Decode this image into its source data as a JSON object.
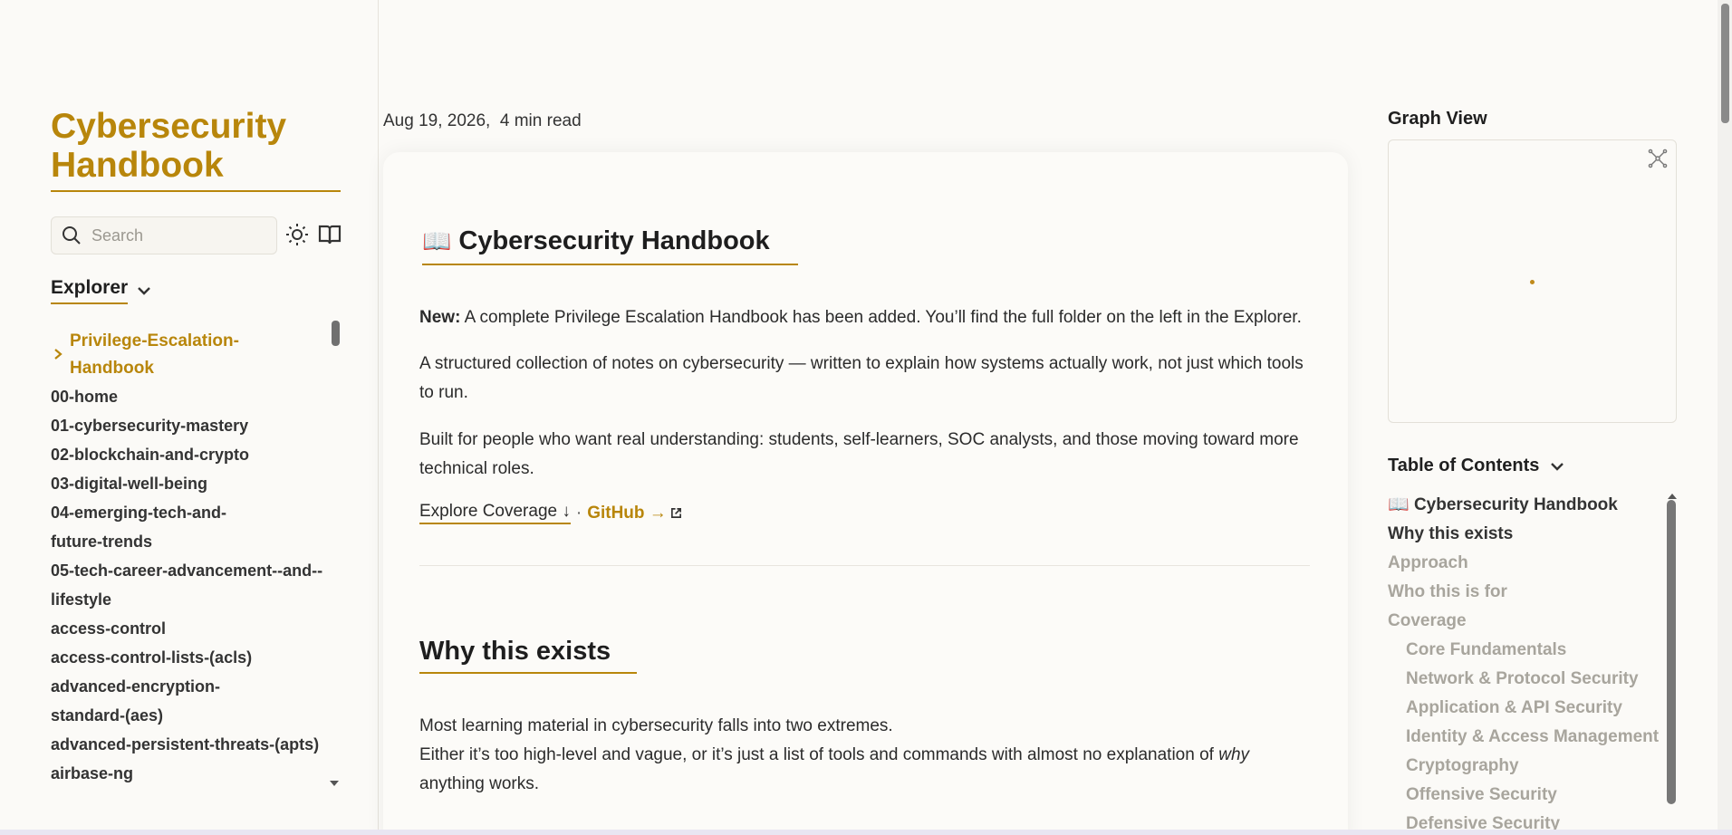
{
  "site": {
    "title": "Cybersecurity Handbook"
  },
  "search": {
    "placeholder": "Search"
  },
  "explorer": {
    "label": "Explorer",
    "folder": "Privilege-Escalation-Handbook",
    "items": [
      "00-home",
      "01-cybersecurity-mastery",
      "02-blockchain-and-crypto",
      "03-digital-well-being",
      "04-emerging-tech-and-future-trends",
      "05-tech-career-advancement--and--lifestyle",
      "access-control",
      "access-control-lists-(acls)",
      "advanced-encryption-standard-(aes)",
      "advanced-persistent-threats-(apts)",
      "airbase-ng"
    ]
  },
  "article": {
    "meta": "Aug 19, 2026,  4 min read",
    "title": "Cybersecurity Handbook",
    "title_icon": "📖",
    "new_label": "New:",
    "new_text": " A complete Privilege Escalation Handbook has been added. You’ll find the full folder on the left in the Explorer.",
    "para1": "A structured collection of notes on cybersecurity — written to explain how systems actually work, not just which tools to run.",
    "para2": "Built for people who want real understanding: students, self-learners, SOC analysts, and those moving toward more technical roles.",
    "explore_link": "Explore Coverage ↓",
    "separator": "·",
    "github_link": "GitHub →",
    "h2": "Why this exists",
    "para3_line1": "Most learning material in cybersecurity falls into two extremes.",
    "para3_line2a": "Either it’s too high-level and vague, or it’s just a list of tools and commands with almost no explanation of ",
    "para3_em": "why",
    "para3_line2b": " anything works."
  },
  "graph": {
    "title": "Graph View"
  },
  "toc": {
    "title": "Table of Contents",
    "first_icon": "📖",
    "items": [
      {
        "label": "Cybersecurity Handbook"
      },
      {
        "label": "Why this exists"
      },
      {
        "label": "Approach"
      },
      {
        "label": "Who this is for"
      },
      {
        "label": "Coverage"
      },
      {
        "label": "Core Fundamentals"
      },
      {
        "label": "Network & Protocol Security"
      },
      {
        "label": "Application & API Security"
      },
      {
        "label": "Identity & Access Management"
      },
      {
        "label": "Cryptography"
      },
      {
        "label": "Offensive Security"
      },
      {
        "label": "Defensive Security"
      }
    ]
  },
  "colors": {
    "accent": "#b8860b",
    "background": "#fbfaf7"
  }
}
